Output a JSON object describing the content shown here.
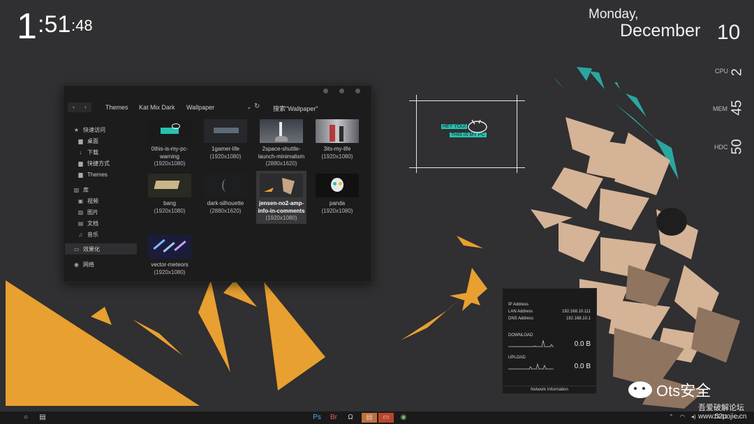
{
  "clock": {
    "hour": "1",
    "minute": ":51",
    "second": ":48"
  },
  "date": {
    "weekday": "Monday,",
    "month": "December",
    "day": "10"
  },
  "system": {
    "cpu_label": "CPU",
    "cpu_value": "2",
    "mem_label": "MEM",
    "mem_value": "45",
    "hdc_label": "HDC",
    "hdc_value": "50"
  },
  "explorer": {
    "nav_back": "‹",
    "nav_forward": "›",
    "breadcrumb": [
      "Themes",
      "Kat Mix Dark",
      "Wallpaper"
    ],
    "dropdown": "⌄",
    "refresh": "↻",
    "search_text": "搜索\"Wallpaper\"",
    "sidebar": [
      {
        "label": "快速访问",
        "icon": "★"
      },
      {
        "label": "桌面",
        "icon": "▆"
      },
      {
        "label": "下载",
        "icon": "↓"
      },
      {
        "label": "快捷方式",
        "icon": "▆"
      },
      {
        "label": "Themes",
        "icon": "▆"
      },
      {
        "label": "库",
        "icon": "▥"
      },
      {
        "label": "视频",
        "icon": "▣"
      },
      {
        "label": "图片",
        "icon": "▨"
      },
      {
        "label": "文档",
        "icon": "▤"
      },
      {
        "label": "音乐",
        "icon": "♫"
      },
      {
        "label": "效果化",
        "icon": "▭"
      },
      {
        "label": "网络",
        "icon": "◉"
      }
    ],
    "files": [
      {
        "name": "0this-is-my-pc-warning",
        "dim": "(1920x1080)"
      },
      {
        "name": "1gamer-life",
        "dim": "(1920x1080)"
      },
      {
        "name": "2space-shuttle-launch-minimalism",
        "dim": "(2880x1620)"
      },
      {
        "name": "3its-my-life",
        "dim": "(1920x1080)"
      },
      {
        "name": "bang",
        "dim": "(1920x1080)"
      },
      {
        "name": "dark-silhouette",
        "dim": "(2880x1620)"
      },
      {
        "name": "jensen-no2-amp-info-in-comments",
        "dim": "(1920x1080)"
      },
      {
        "name": "panda",
        "dim": "(1920x1080)"
      },
      {
        "name": "vector-meteors",
        "dim": "(1920x1080)"
      }
    ]
  },
  "widget": {
    "tag1": "HEY YOU!",
    "tag2": "THIS IS MY PC"
  },
  "network": {
    "ip_label": "IP Address",
    "lan_label": "LAN Address",
    "lan_value": "192.168.10.111",
    "dns_label": "DNS Address",
    "dns_value": "192.168.10.1",
    "download_label": "DOWNLOAD",
    "download_value": "0.0 B",
    "upload_label": "UPLOAD",
    "upload_value": "0.0 B",
    "footer": "Network Information"
  },
  "taskbar": {
    "apps": [
      "Ps",
      "Br",
      "Ω",
      "▤",
      "▭",
      "◉"
    ],
    "tray_time": "13:51"
  },
  "watermark": {
    "brand": "Ots安全",
    "forum": "吾爱破解论坛",
    "url": "www.52pojie.cn"
  },
  "colors": {
    "accent_orange": "#e8a030",
    "teal": "#2aa6a0",
    "beige": "#d4b396",
    "dark": "#302f31"
  }
}
